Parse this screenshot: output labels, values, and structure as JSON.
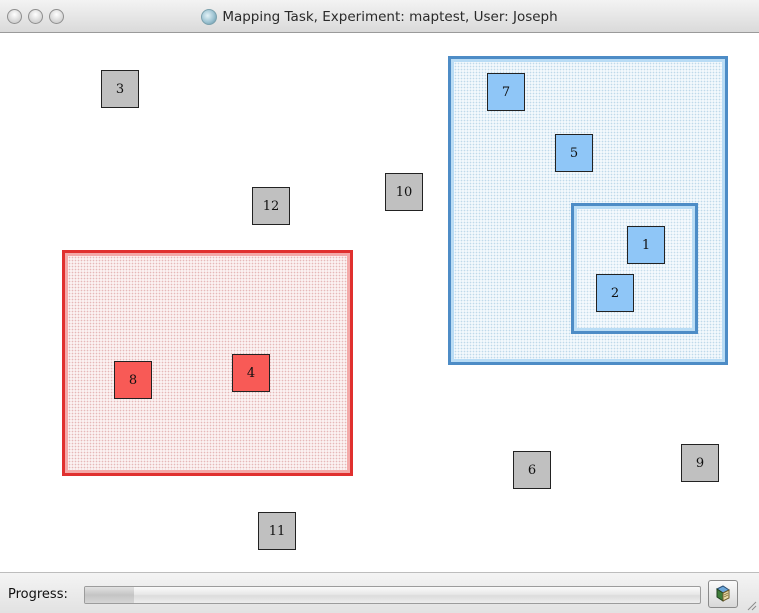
{
  "window": {
    "title": "Mapping Task, Experiment: maptest, User: Joseph",
    "controls": [
      "close",
      "minimize",
      "zoom"
    ]
  },
  "canvas": {
    "regions": [
      {
        "id": "red",
        "color": "#e0302f",
        "contains": [
          "8",
          "4"
        ]
      },
      {
        "id": "blue-outer",
        "color": "#4d8cc6",
        "contains": [
          "7",
          "5",
          "1",
          "2"
        ]
      },
      {
        "id": "blue-inner",
        "color": "#4d8cc6",
        "contains": [
          "1",
          "2"
        ]
      }
    ],
    "items": {
      "n1": "1",
      "n2": "2",
      "n3": "3",
      "n4": "4",
      "n5": "5",
      "n6": "6",
      "n7": "7",
      "n8": "8",
      "n9": "9",
      "n10": "10",
      "n11": "11",
      "n12": "12"
    },
    "colors": {
      "unassigned": "#c0c0c0",
      "red": "#f85a56",
      "blue": "#8fc6f7"
    }
  },
  "statusbar": {
    "progress_label": "Progress:",
    "progress_fraction": 0.08,
    "action_icon": "book-icon"
  }
}
